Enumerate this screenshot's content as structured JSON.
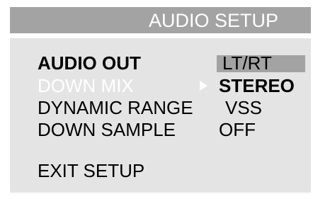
{
  "title": "AUDIO SETUP",
  "items": [
    {
      "label": "AUDIO OUT",
      "value": "LT/RT"
    },
    {
      "label": "DOWN MIX",
      "value": "STEREO"
    },
    {
      "label": "DYNAMIC RANGE",
      "value": "VSS"
    },
    {
      "label": "DOWN SAMPLE",
      "value": "OFF"
    },
    {
      "label": "EXIT SETUP"
    }
  ],
  "colors": {
    "panel": "#e4e4e4",
    "title_bar": "#a3a3a3",
    "highlight": "#a3a3a3",
    "selected_text": "#ffffff"
  },
  "icons": {
    "submenu_arrow": "right-triangle-arrow-icon"
  }
}
